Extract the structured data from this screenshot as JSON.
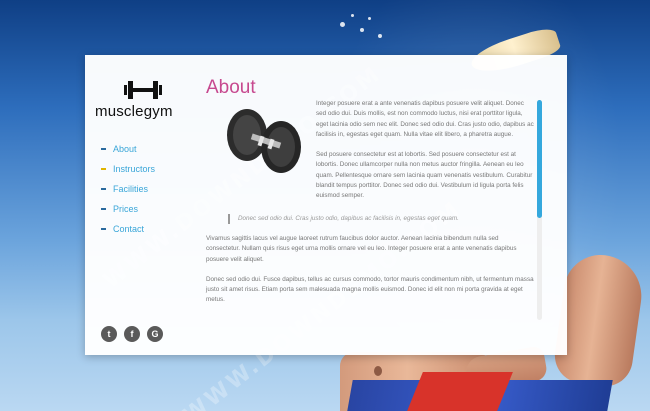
{
  "brand": {
    "name": "musclegym"
  },
  "nav": {
    "items": [
      {
        "label": "About",
        "active": false
      },
      {
        "label": "Instructors",
        "active": true
      },
      {
        "label": "Facilities",
        "active": false
      },
      {
        "label": "Prices",
        "active": false
      },
      {
        "label": "Contact",
        "active": false
      }
    ]
  },
  "social": {
    "twitter_glyph": "t",
    "facebook_glyph": "f",
    "google_glyph": "G"
  },
  "page": {
    "title": "About",
    "paragraphs": [
      "Integer posuere erat a ante venenatis dapibus posuere velit aliquet. Donec sed odio dui. Duis mollis, est non commodo luctus, nisi erat porttitor ligula, eget lacinia odio sem nec elit. Donec sed odio dui. Cras justo odio, dapibus ac facilisis in, egestas eget quam. Nulla vitae elit libero, a pharetra augue.",
      "Sed posuere consectetur est at lobortis. Sed posuere consectetur est at lobortis. Donec ullamcorper nulla non metus auctor fringilla. Aenean eu leo quam. Pellentesque ornare sem lacinia quam venenatis vestibulum. Curabitur blandit tempus porttitor. Donec sed odio dui. Vestibulum id ligula porta felis euismod semper.",
      "Vivamus sagittis lacus vel augue laoreet rutrum faucibus dolor auctor. Aenean lacinia bibendum nulla sed consectetur. Nullam quis risus eget urna mollis ornare vel eu leo. Integer posuere erat a ante venenatis dapibus posuere velit aliquet.",
      "Donec sed odio dui. Fusce dapibus, tellus ac cursus commodo, tortor mauris condimentum nibh, ut fermentum massa justo sit amet risus. Etiam porta sem malesuada magna mollis euismod. Donec id elit non mi porta gravida at eget metus."
    ],
    "quote": "Donec sed odio dui. Cras justo odio, dapibus ac facilisis in, egestas eget quam."
  },
  "watermark": {
    "text": "WWW.DOWNDEMO.COM"
  },
  "colors": {
    "accent_title": "#c7498f",
    "nav_link": "#3aa6d8",
    "scroll_thumb": "#35a8dd",
    "nav_active_marker": "#e0b400"
  }
}
